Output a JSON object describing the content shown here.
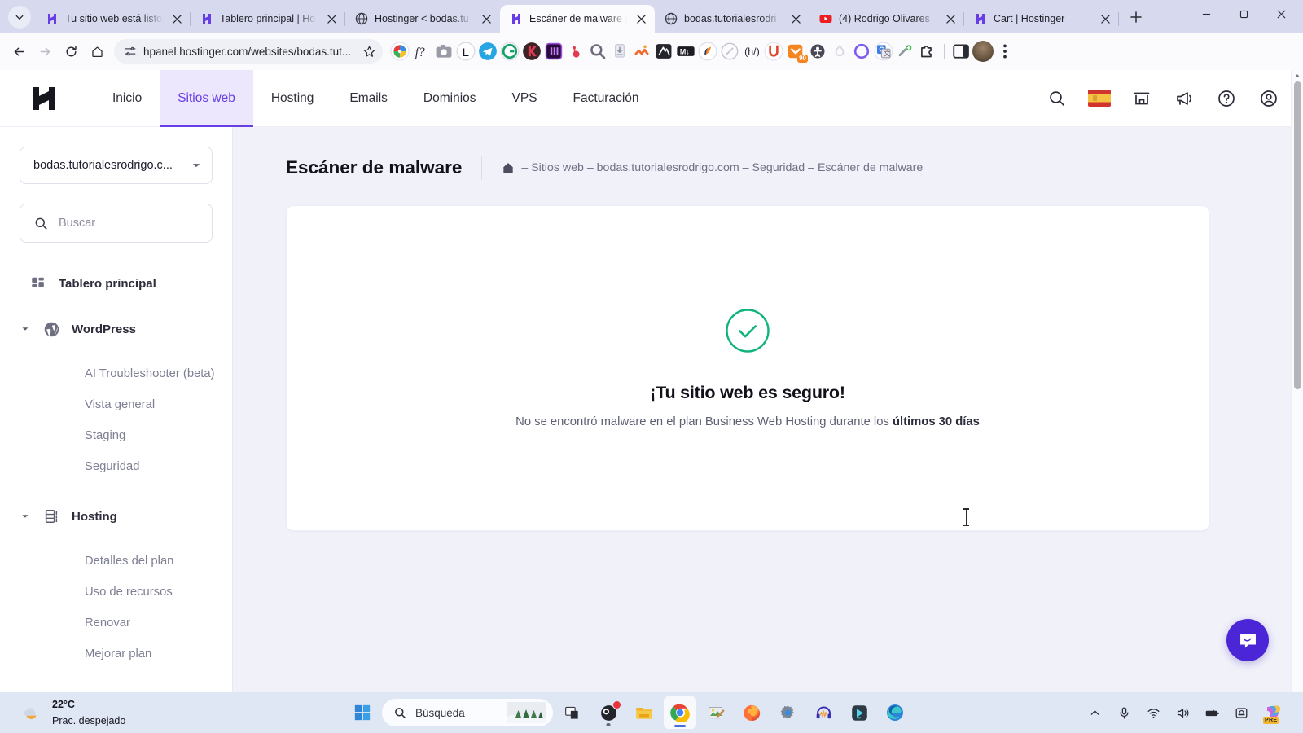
{
  "browser": {
    "tab_list_icon": "chevron-down-icon",
    "tabs": [
      {
        "title": "Tu sitio web está listo",
        "favicon": "hostinger-icon",
        "active": false
      },
      {
        "title": "Tablero principal | Ho",
        "favicon": "hostinger-icon",
        "active": false
      },
      {
        "title": "Hostinger < bodas.tu",
        "favicon": "globe-icon",
        "active": false
      },
      {
        "title": "Escáner de malware |",
        "favicon": "hostinger-icon",
        "active": true
      },
      {
        "title": "bodas.tutorialesrodri",
        "favicon": "globe-icon",
        "active": false
      },
      {
        "title": "(4) Rodrigo Olivares",
        "favicon": "youtube-icon",
        "active": false
      },
      {
        "title": "Cart | Hostinger",
        "favicon": "hostinger-icon",
        "active": false
      }
    ],
    "new_tab_label": "+",
    "window_controls": {
      "minimize": "minimize-icon",
      "maximize": "maximize-icon",
      "close": "close-icon"
    },
    "nav": {
      "back": "back-arrow-icon",
      "forward": "forward-arrow-icon",
      "reload": "reload-icon",
      "home": "home-icon"
    },
    "omnibox": {
      "site_info_icon": "page-settings-icon",
      "url": "hpanel.hostinger.com/websites/bodas.tut...",
      "bookmark_icon": "star-icon"
    },
    "extensions": [
      "color-picker-icon",
      "font-finder-icon",
      "screenshot-icon",
      "lastpass-icon",
      "telegram-icon",
      "grammarly-icon",
      "kick-icon",
      "adobe-icon",
      "bitly-icon",
      "zoom-search-icon",
      "downloads-icon",
      "clickup-icon",
      "video-editor-icon",
      "markdown-icon",
      "similarweb-icon",
      "edit-icon",
      "hreflang-icon",
      "unbounce-icon",
      "pocket-icon",
      "accessibility-icon",
      "droplet-icon",
      "loom-icon",
      "google-translate-icon",
      "merge-icon",
      "puzzle-piece-icon"
    ],
    "extension_badge": "90",
    "side_panel_icon": "side-panel-icon",
    "profile_icon": "avatar",
    "menu_icon": "three-dots-menu-icon"
  },
  "hpanel": {
    "logo": "hostinger-logo",
    "nav": [
      {
        "label": "Inicio",
        "active": false
      },
      {
        "label": "Sitios web",
        "active": true
      },
      {
        "label": "Hosting",
        "active": false
      },
      {
        "label": "Emails",
        "active": false
      },
      {
        "label": "Dominios",
        "active": false
      },
      {
        "label": "VPS",
        "active": false
      },
      {
        "label": "Facturación",
        "active": false
      }
    ],
    "header_actions": [
      "search-icon",
      "language-flag-spain-icon",
      "store-icon",
      "megaphone-icon",
      "help-icon",
      "account-icon"
    ],
    "accent_color": "#673de6"
  },
  "sidebar": {
    "domain_selector": {
      "value": "bodas.tutorialesrodrigo.c...",
      "chevron": "chevron-down-icon"
    },
    "search": {
      "placeholder": "Buscar",
      "icon": "search-icon"
    },
    "items": [
      {
        "label": "Tablero principal",
        "icon": "dashboard-icon",
        "type": "group",
        "expandable": false
      },
      {
        "label": "WordPress",
        "icon": "wordpress-icon",
        "type": "group",
        "expandable": true,
        "expanded": true
      },
      {
        "label": "AI Troubleshooter (beta)",
        "type": "sub"
      },
      {
        "label": "Vista general",
        "type": "sub"
      },
      {
        "label": "Staging",
        "type": "sub"
      },
      {
        "label": "Seguridad",
        "type": "sub"
      },
      {
        "label": "Hosting",
        "icon": "server-icon",
        "type": "group",
        "expandable": true,
        "expanded": true
      },
      {
        "label": "Detalles del plan",
        "type": "sub"
      },
      {
        "label": "Uso de recursos",
        "type": "sub"
      },
      {
        "label": "Renovar",
        "type": "sub"
      },
      {
        "label": "Mejorar plan",
        "type": "sub"
      }
    ]
  },
  "main": {
    "page_title": "Escáner de malware",
    "breadcrumb": {
      "home_icon": "home-icon",
      "text": "– Sitios web – bodas.tutorialesrodrigo.com – Seguridad – Escáner de malware"
    },
    "status_card": {
      "icon": "check-circle-icon",
      "icon_color": "#11b37c",
      "heading": "¡Tu sitio web es seguro!",
      "body_prefix": "No se encontró malware en el plan Business Web Hosting durante los ",
      "body_strong": "últimos 30 días"
    },
    "chat_button": {
      "icon": "intercom-chat-icon",
      "color": "#4a26d6"
    }
  },
  "taskbar": {
    "weather": {
      "temperature": "22°C",
      "condition": "Prac. despejado",
      "icon": "moon-cloud-icon"
    },
    "start_button": "windows-start-icon",
    "search": {
      "placeholder": "Búsqueda",
      "icon": "search-icon",
      "thumbnail": "trees-image"
    },
    "apps": [
      {
        "name": "task-view-icon",
        "state": "idle"
      },
      {
        "name": "obs-studio-icon",
        "state": "running",
        "badge": "red-dot"
      },
      {
        "name": "file-explorer-icon",
        "state": "idle"
      },
      {
        "name": "google-chrome-icon",
        "state": "active"
      },
      {
        "name": "paint-icon",
        "state": "idle"
      },
      {
        "name": "firefox-icon",
        "state": "idle"
      },
      {
        "name": "settings-icon",
        "state": "idle"
      },
      {
        "name": "audacity-icon",
        "state": "idle"
      },
      {
        "name": "filmora-icon",
        "state": "idle"
      },
      {
        "name": "microsoft-edge-icon",
        "state": "idle"
      }
    ],
    "tray": [
      "show-hidden-icons-chevron",
      "microphone-icon",
      "wifi-icon",
      "volume-icon",
      "battery-icon",
      "notification-icon"
    ],
    "copilot": {
      "icon": "copilot-icon",
      "badge": "PRE"
    }
  }
}
